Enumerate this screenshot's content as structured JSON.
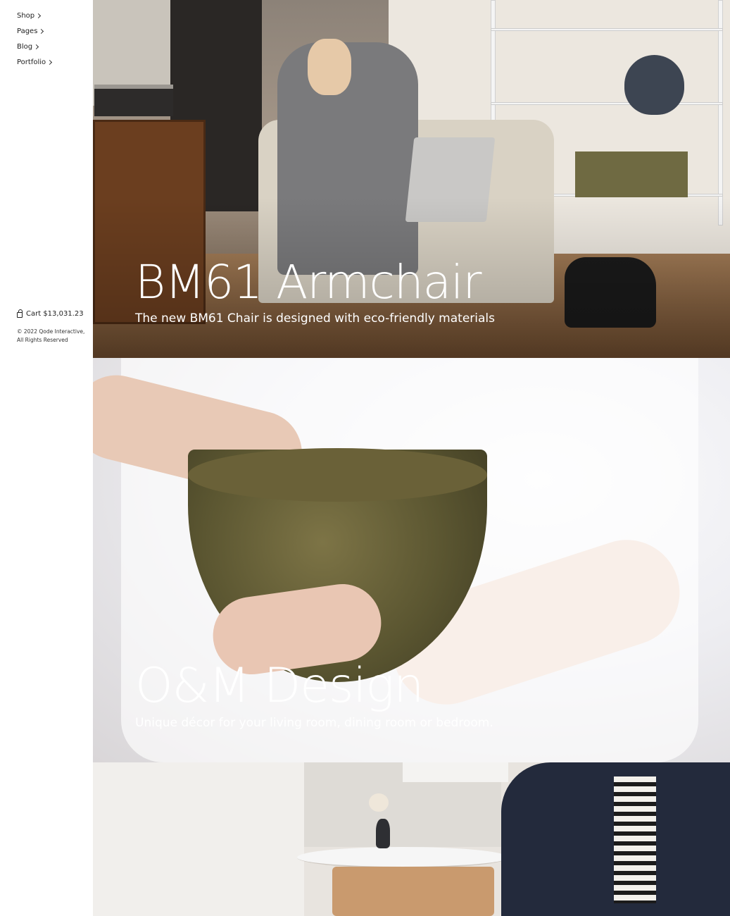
{
  "sidebar": {
    "nav": [
      {
        "label": "Shop"
      },
      {
        "label": "Pages"
      },
      {
        "label": "Blog"
      },
      {
        "label": "Portfolio"
      }
    ],
    "cart": {
      "label": "Cart $13,031.23",
      "icon": "shopping-bag-icon"
    },
    "copyright": "© 2022 Qode Interactive, All Rights Reserved"
  },
  "hero": [
    {
      "title": "BM61 Armchair",
      "subtitle": "The new BM61 Chair is designed with eco-friendly materials"
    },
    {
      "title": "O&M Design",
      "subtitle": "Unique décor for your living room, dining room or bedroom."
    }
  ],
  "colors": {
    "text_light": "#ffffff",
    "text_dark": "#1a1a1a",
    "background": "#ffffff"
  }
}
